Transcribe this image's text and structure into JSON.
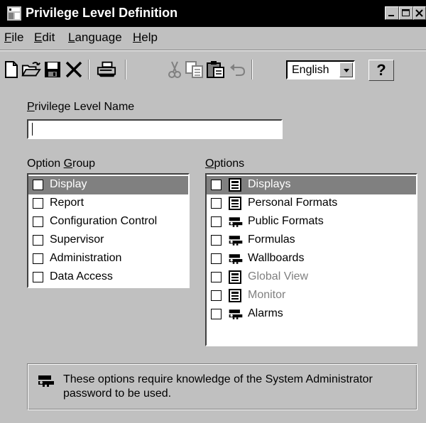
{
  "window": {
    "title": "Privilege Level Definition"
  },
  "menu": {
    "items": [
      {
        "mnemonic": "F",
        "rest": "ile"
      },
      {
        "mnemonic": "E",
        "rest": "dit"
      },
      {
        "mnemonic": "L",
        "rest": "anguage"
      },
      {
        "mnemonic": "H",
        "rest": "elp"
      }
    ]
  },
  "toolbar": {
    "icons": [
      "new-file-icon",
      "open-folder-icon",
      "save-disk-icon",
      "delete-x-icon",
      "print-icon",
      "cut-scissors-icon",
      "copy-icon",
      "paste-clipboard-icon",
      "undo-icon",
      "help-question-icon"
    ],
    "language_value": "English",
    "help_label": "?"
  },
  "form": {
    "name_label_mnemonic": "P",
    "name_label_rest": "rivilege Level Name",
    "name_value": "",
    "option_group_label_pre": "Option ",
    "option_group_label_mnemonic": "G",
    "option_group_label_rest": "roup",
    "options_label_mnemonic": "O",
    "options_label_rest": "ptions"
  },
  "option_groups": [
    {
      "label": "Display",
      "selected": true
    },
    {
      "label": "Report",
      "selected": false
    },
    {
      "label": "Configuration Control",
      "selected": false
    },
    {
      "label": "Supervisor",
      "selected": false
    },
    {
      "label": "Administration",
      "selected": false
    },
    {
      "label": "Data Access",
      "selected": false
    }
  ],
  "options": [
    {
      "label": "Displays",
      "icon": "display-icon",
      "selected": true,
      "enabled": true
    },
    {
      "label": "Personal Formats",
      "icon": "display-icon",
      "selected": false,
      "enabled": true
    },
    {
      "label": "Public Formats",
      "icon": "key-icon",
      "selected": false,
      "enabled": true
    },
    {
      "label": "Formulas",
      "icon": "key-icon",
      "selected": false,
      "enabled": true
    },
    {
      "label": "Wallboards",
      "icon": "key-icon",
      "selected": false,
      "enabled": true
    },
    {
      "label": "Global View",
      "icon": "display-icon",
      "selected": false,
      "enabled": false
    },
    {
      "label": "Monitor",
      "icon": "display-icon",
      "selected": false,
      "enabled": false
    },
    {
      "label": "Alarms",
      "icon": "key-icon",
      "selected": false,
      "enabled": true
    }
  ],
  "note": {
    "line1": "These options require knowledge of the System  Administrator",
    "line2": "password to be used."
  },
  "colors": {
    "face": "#c0c0c0",
    "selection": "#808080",
    "disabled_text": "#808080"
  }
}
